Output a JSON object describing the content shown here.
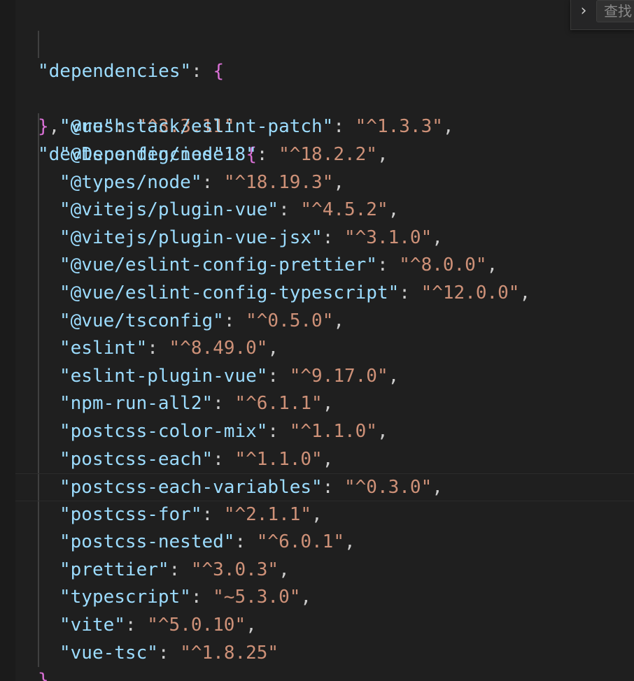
{
  "find_widget": {
    "placeholder": "查找",
    "toggle_glyph": "›"
  },
  "code": {
    "dependencies_key": "\"dependencies\"",
    "dependencies": [
      {
        "key": "\"vue\"",
        "value": "\"^3.3.11\""
      }
    ],
    "devDependencies_key": "\"devDependencies\"",
    "devDependencies": [
      {
        "key": "\"@rushstack/eslint-patch\"",
        "value": "\"^1.3.3\""
      },
      {
        "key": "\"@tsconfig/node18\"",
        "value": "\"^18.2.2\""
      },
      {
        "key": "\"@types/node\"",
        "value": "\"^18.19.3\""
      },
      {
        "key": "\"@vitejs/plugin-vue\"",
        "value": "\"^4.5.2\""
      },
      {
        "key": "\"@vitejs/plugin-vue-jsx\"",
        "value": "\"^3.1.0\""
      },
      {
        "key": "\"@vue/eslint-config-prettier\"",
        "value": "\"^8.0.0\""
      },
      {
        "key": "\"@vue/eslint-config-typescript\"",
        "value": "\"^12.0.0\""
      },
      {
        "key": "\"@vue/tsconfig\"",
        "value": "\"^0.5.0\""
      },
      {
        "key": "\"eslint\"",
        "value": "\"^8.49.0\""
      },
      {
        "key": "\"eslint-plugin-vue\"",
        "value": "\"^9.17.0\""
      },
      {
        "key": "\"npm-run-all2\"",
        "value": "\"^6.1.1\""
      },
      {
        "key": "\"postcss-color-mix\"",
        "value": "\"^1.1.0\""
      },
      {
        "key": "\"postcss-each\"",
        "value": "\"^1.1.0\""
      },
      {
        "key": "\"postcss-each-variables\"",
        "value": "\"^0.3.0\""
      },
      {
        "key": "\"postcss-for\"",
        "value": "\"^2.1.1\""
      },
      {
        "key": "\"postcss-nested\"",
        "value": "\"^6.0.1\""
      },
      {
        "key": "\"prettier\"",
        "value": "\"^3.0.3\""
      },
      {
        "key": "\"typescript\"",
        "value": "\"~5.3.0\""
      },
      {
        "key": "\"vite\"",
        "value": "\"^5.0.10\""
      },
      {
        "key": "\"vue-tsc\"",
        "value": "\"^1.8.25\""
      }
    ],
    "current_line_index": 13
  },
  "colors": {
    "background": "#1f1f1f",
    "key": "#9cdcfe",
    "string": "#ce9178",
    "brace": "#da70d6",
    "punctuation": "#cccccc"
  }
}
